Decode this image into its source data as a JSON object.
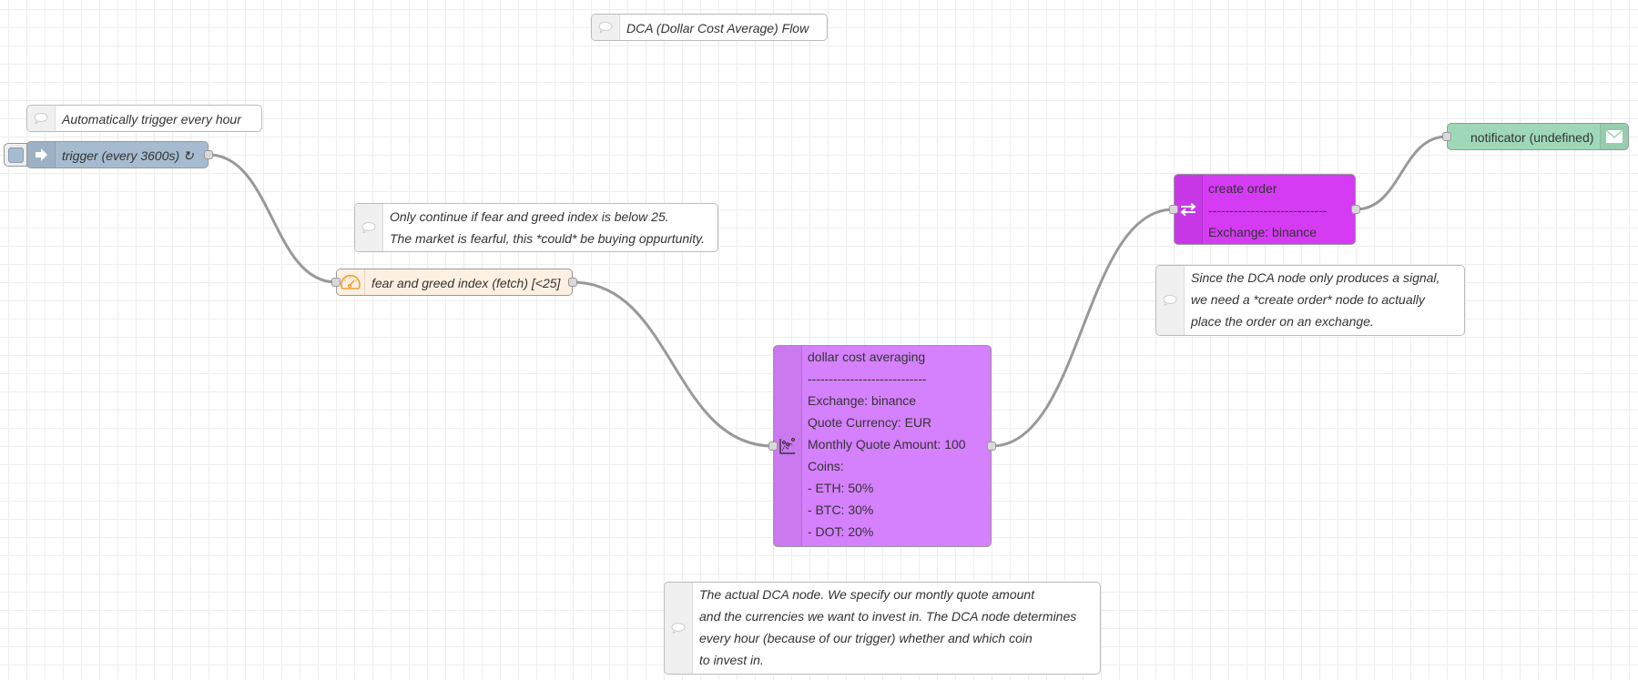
{
  "flow": {
    "title_comment": "DCA (Dollar Cost Average) Flow"
  },
  "comments": {
    "trigger_hint": "Automatically trigger every hour",
    "fear_hint": [
      "Only continue if fear and greed index is below 25.",
      "The market is fearful, this *could* be buying oppurtunity."
    ],
    "create_order_hint": [
      "Since the DCA node only produces a signal,",
      "we need a *create order* node to actually",
      "place the order on an exchange."
    ],
    "dca_hint": [
      "The actual DCA node. We specify our montly quote amount",
      "and the currencies we want to invest in. The DCA node determines",
      "every hour (because of our trigger) whether and which coin",
      "to invest in."
    ]
  },
  "nodes": {
    "trigger": {
      "label": "trigger (every 3600s) ↻",
      "icon": "arrow-right-icon",
      "color": "#a6bbcf"
    },
    "fear_greed": {
      "label": "fear and greed index (fetch) [<25]",
      "icon": "gauge-icon",
      "color": "#fdf0e2"
    },
    "dca": {
      "lines": [
        "dollar cost averaging",
        "----------------------------",
        "Exchange: binance",
        "Quote Currency: EUR",
        "Monthly Quote Amount: 100",
        "Coins:",
        "- ETH: 50%",
        "- BTC: 30%",
        "- DOT: 20%"
      ],
      "icon": "chart-icon",
      "color": "#d580fc"
    },
    "create_order": {
      "lines": [
        "create order",
        "----------------------------",
        "Exchange: binance"
      ],
      "icon": "swap-arrows-icon",
      "color": "#d43bf3"
    },
    "notificator": {
      "label": "notificator (undefined)",
      "icon": "envelope-icon",
      "color": "#9fd8b9"
    }
  }
}
